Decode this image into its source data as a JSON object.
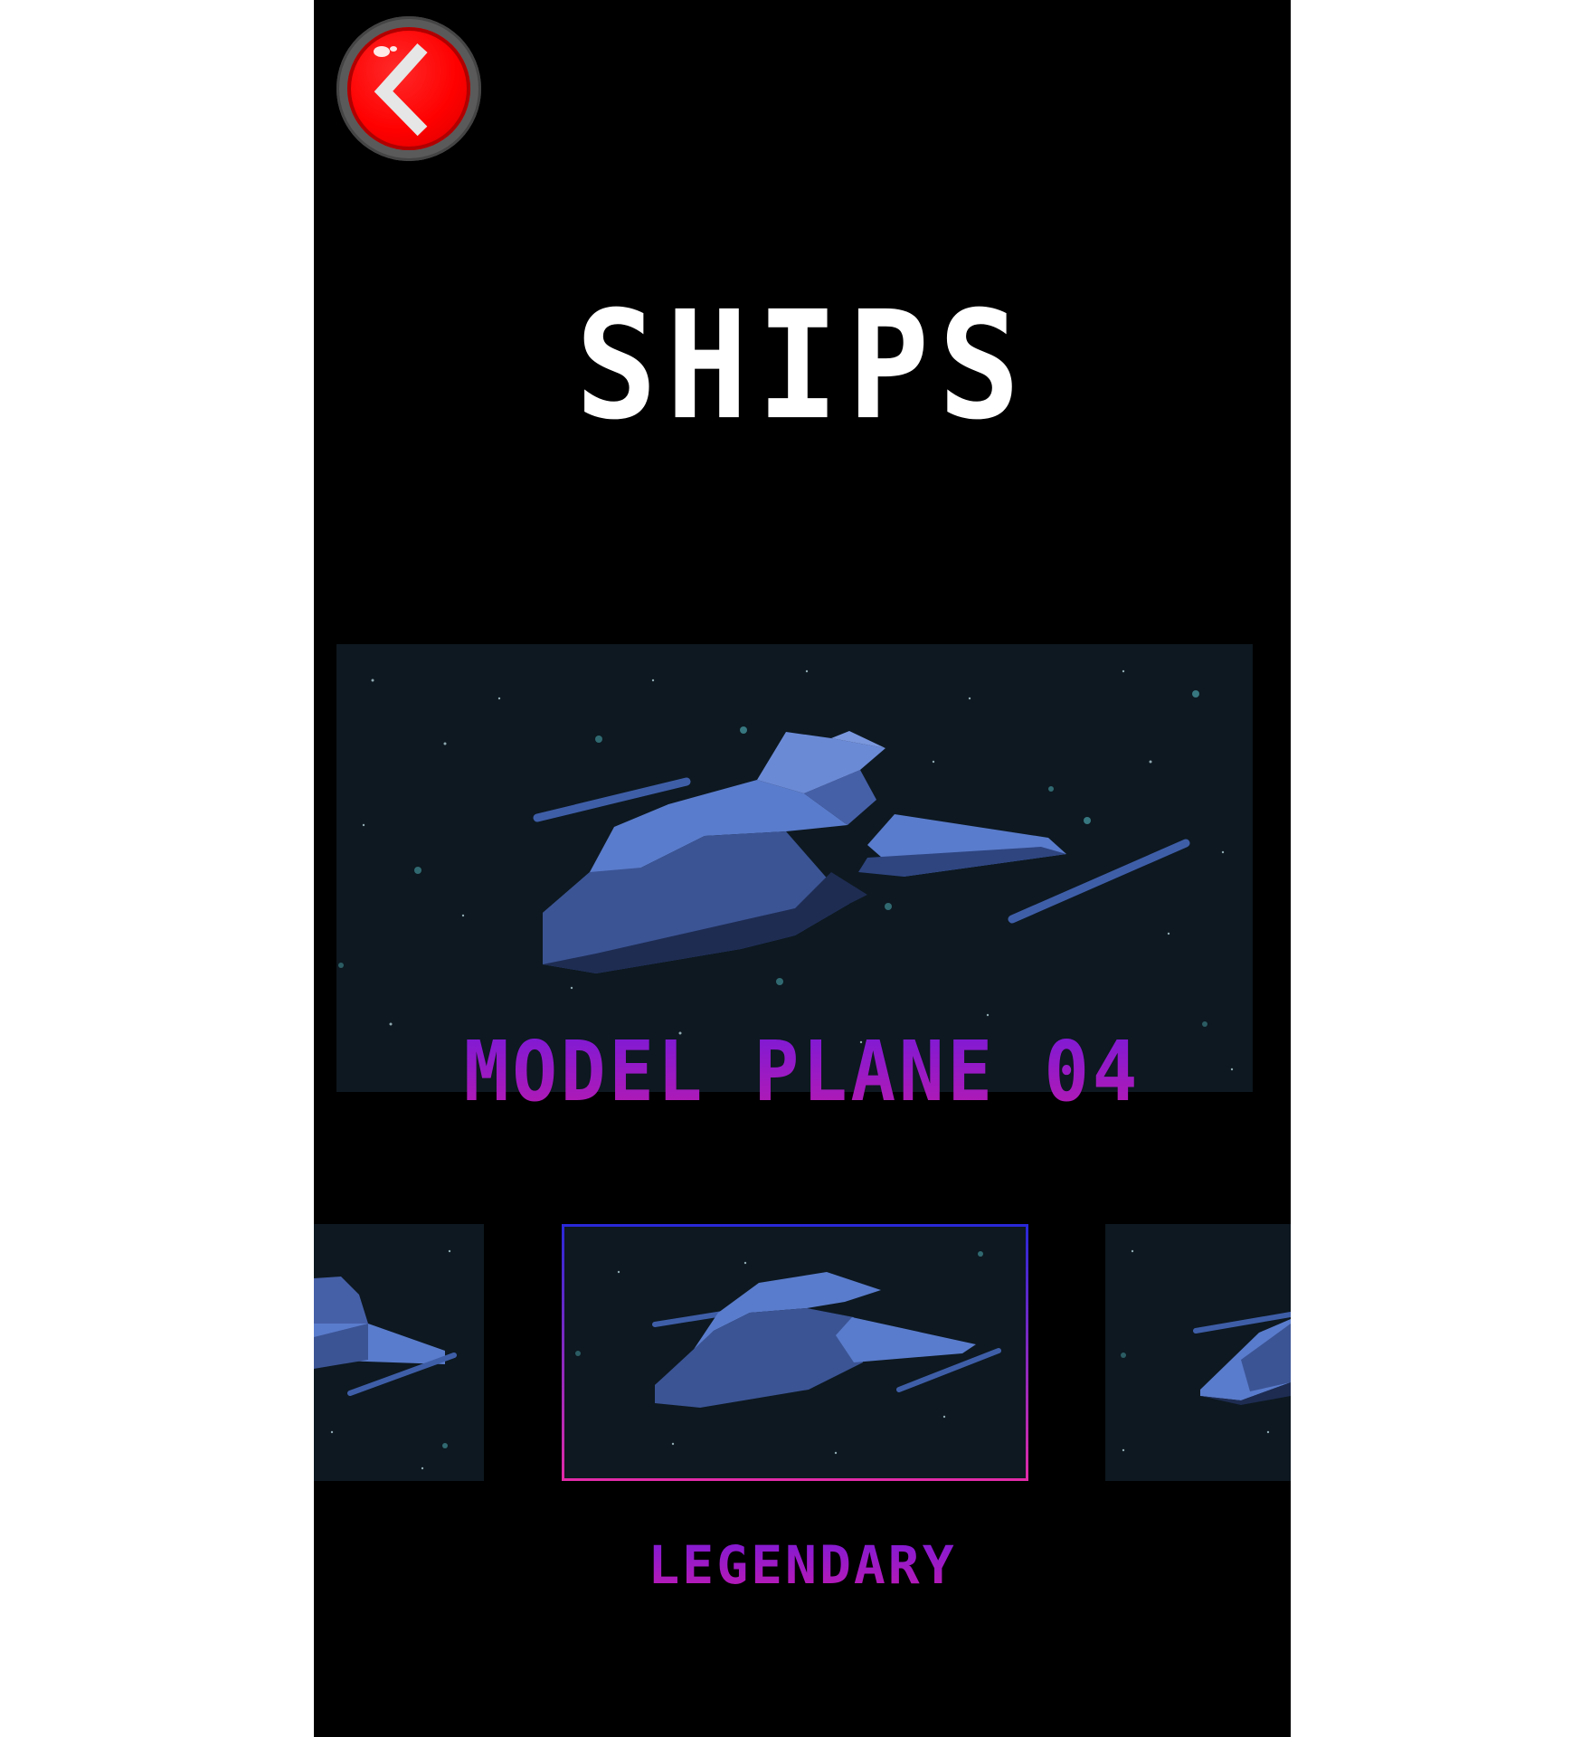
{
  "header": {
    "back_icon": "chevron-left-icon",
    "title": "SHIPS"
  },
  "selected_ship": {
    "name": "MODEL PLANE 04",
    "rarity": "LEGENDARY"
  },
  "carousel": {
    "thumbnails": [
      "previous-ship",
      "selected-ship",
      "next-ship"
    ]
  },
  "colors": {
    "background": "#000000",
    "title": "#ffffff",
    "name_gradient_top": "#7a1ad8",
    "name_gradient_bottom": "#b81ab0",
    "back_button": "#ff0000",
    "space": "#0d1820",
    "ship": "#5a7ccc"
  }
}
